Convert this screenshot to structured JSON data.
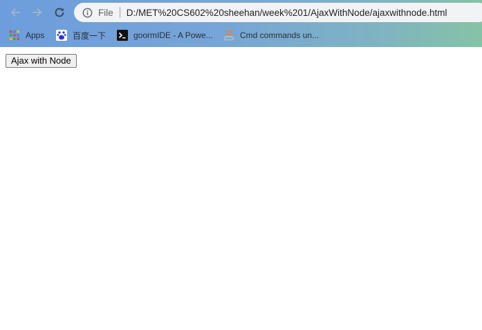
{
  "browser": {
    "url_scheme_label": "File",
    "url": "D:/MET%20CS602%20sheehan/week%201/AjaxWithNode/ajaxwithnode.html",
    "icons": {
      "back": "arrow-left-icon",
      "forward": "arrow-right-icon",
      "reload": "reload-icon",
      "info": "info-icon"
    }
  },
  "bookmarks": [
    {
      "label": "Apps",
      "icon": "apps-grid-icon"
    },
    {
      "label": "百度一下",
      "icon": "baidu-paw-icon"
    },
    {
      "label": "goormIDE - A Powe...",
      "icon": "terminal-icon"
    },
    {
      "label": "Cmd commands un...",
      "icon": "stack-icon"
    }
  ],
  "page": {
    "button_label": "Ajax with Node"
  },
  "colors": {
    "chrome_start": "#6d9ddc",
    "chrome_end": "#86c3a6",
    "omnibox": "#f1f3f4"
  }
}
